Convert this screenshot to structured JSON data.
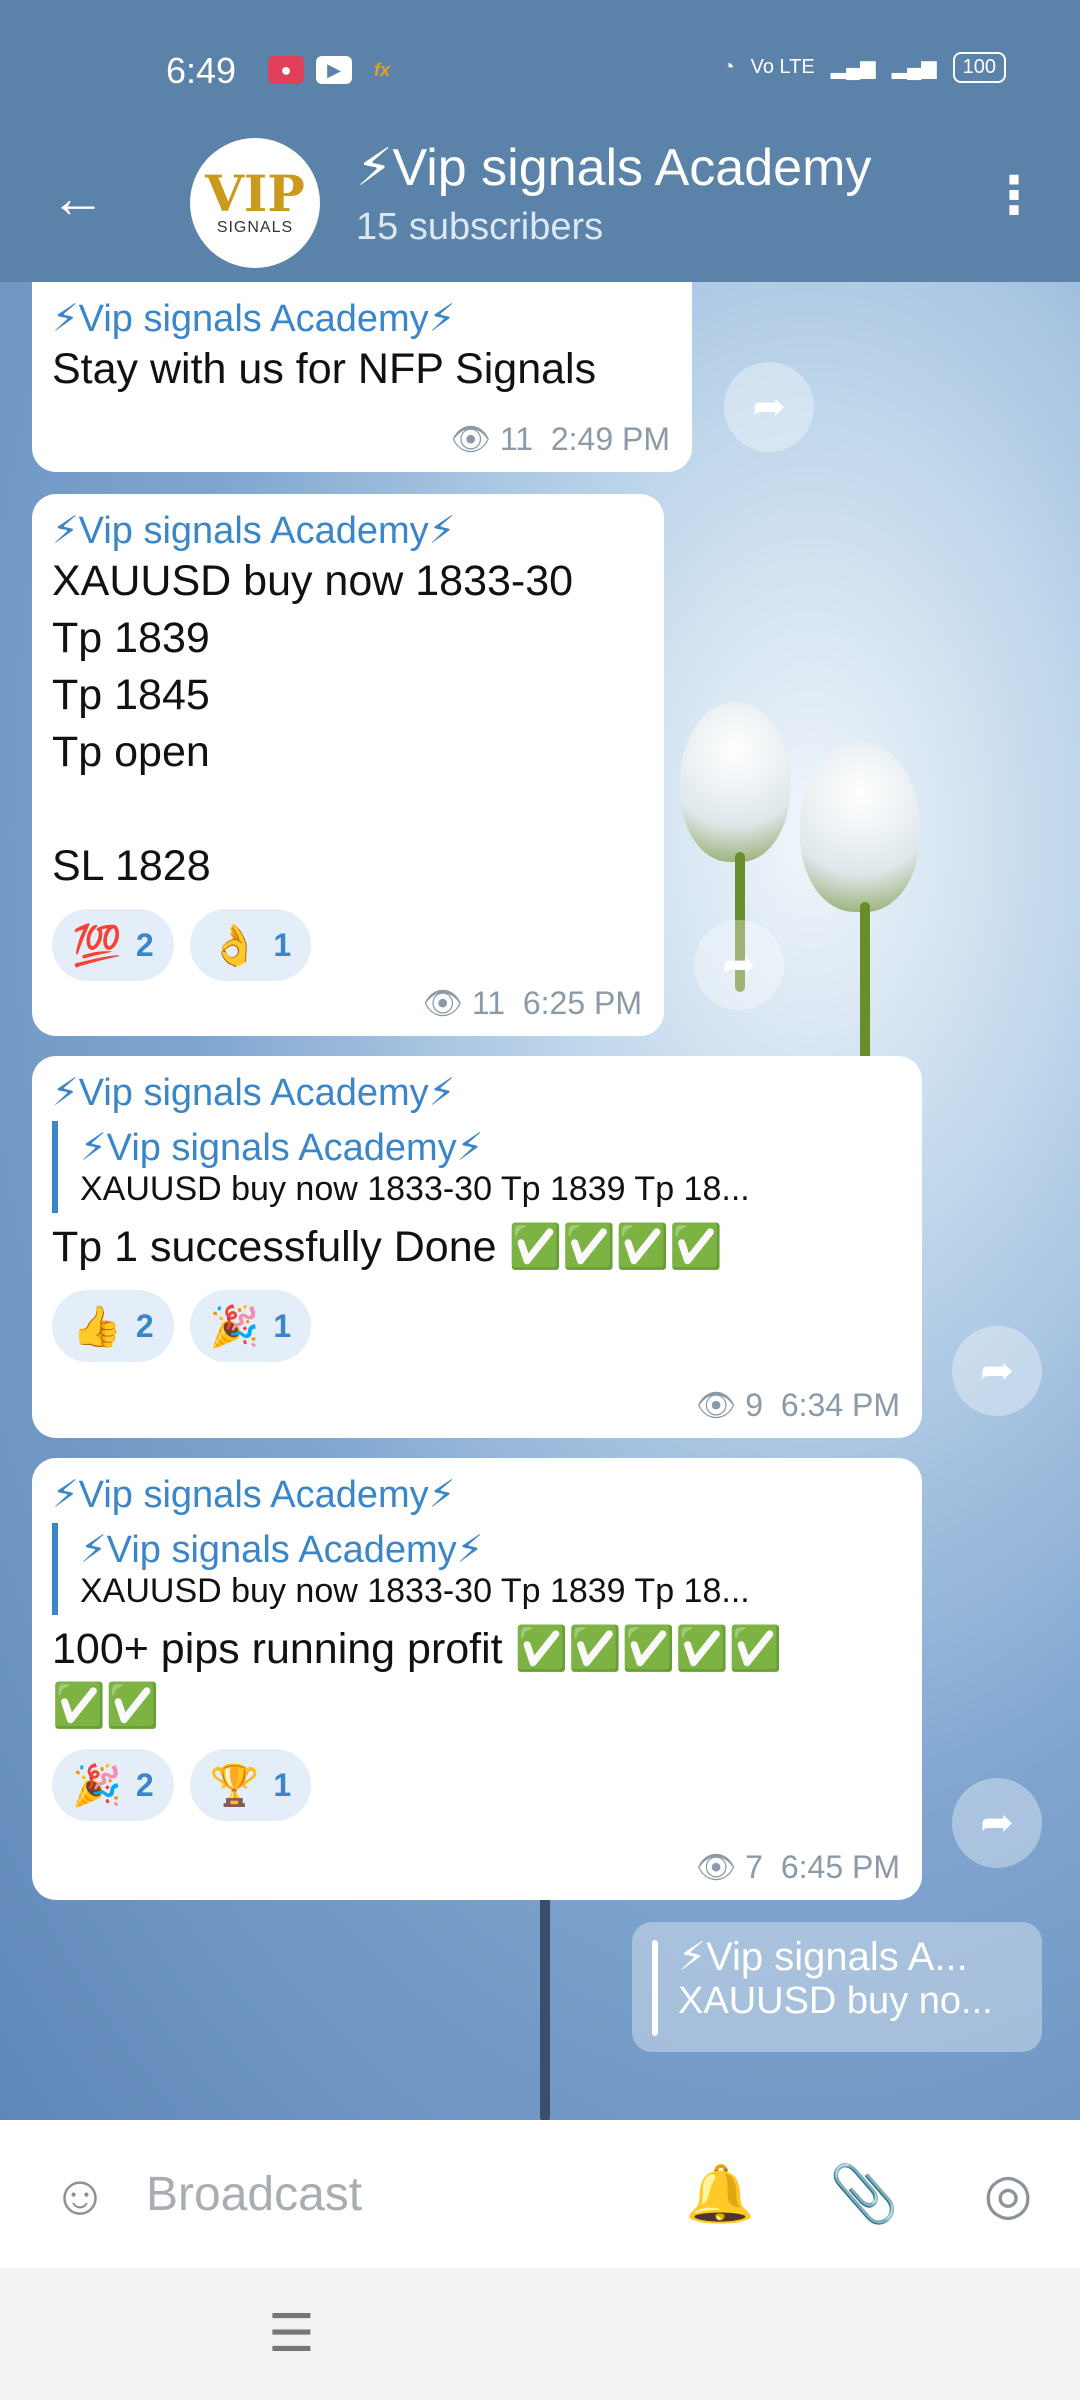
{
  "status_bar": {
    "time": "6:49",
    "app_icons": [
      "screen-record-icon",
      "youtube-icon",
      "fx-icon"
    ],
    "network": "Vo LTE",
    "battery": "100"
  },
  "header": {
    "title": "⚡Vip signals Academy",
    "subscribers": "15 subscribers",
    "avatar_line1": "VIP",
    "avatar_line2": "SIGNALS"
  },
  "messages": [
    {
      "author": "⚡Vip signals Academy⚡",
      "text": "Stay with us for NFP Signals",
      "views": "11",
      "time": "2:49 PM"
    },
    {
      "author": "⚡Vip signals Academy⚡",
      "text": "XAUUSD buy now 1833-30\nTp 1839\nTp 1845\nTp open\n\nSL 1828",
      "reactions": [
        {
          "emoji": "💯",
          "count": "2"
        },
        {
          "emoji": "👌",
          "count": "1"
        }
      ],
      "views": "11",
      "time": "6:25 PM"
    },
    {
      "author": "⚡Vip signals Academy⚡",
      "quote_author": "⚡Vip signals Academy⚡",
      "quote_text": "XAUUSD buy now 1833-30 Tp 1839 Tp 18...",
      "text": "Tp 1 successfully Done ✅✅✅✅",
      "reactions": [
        {
          "emoji": "👍",
          "count": "2"
        },
        {
          "emoji": "🎉",
          "count": "1"
        }
      ],
      "views": "9",
      "time": "6:34 PM"
    },
    {
      "author": "⚡Vip signals Academy⚡",
      "quote_author": "⚡Vip signals Academy⚡",
      "quote_text": "XAUUSD buy now 1833-30 Tp 1839 Tp 18...",
      "text": "100+ pips running profit ✅✅✅✅✅\n✅✅",
      "reactions": [
        {
          "emoji": "🎉",
          "count": "2"
        },
        {
          "emoji": "🏆",
          "count": "1"
        }
      ],
      "views": "7",
      "time": "6:45 PM"
    }
  ],
  "pinned": {
    "author": "⚡Vip signals A...",
    "text": "XAUUSD buy no..."
  },
  "composer": {
    "placeholder": "Broadcast"
  },
  "icons": {
    "eye": "👁",
    "forward": "➦"
  },
  "colors": {
    "header": "#5b82a8",
    "accent": "#3a86c8"
  }
}
